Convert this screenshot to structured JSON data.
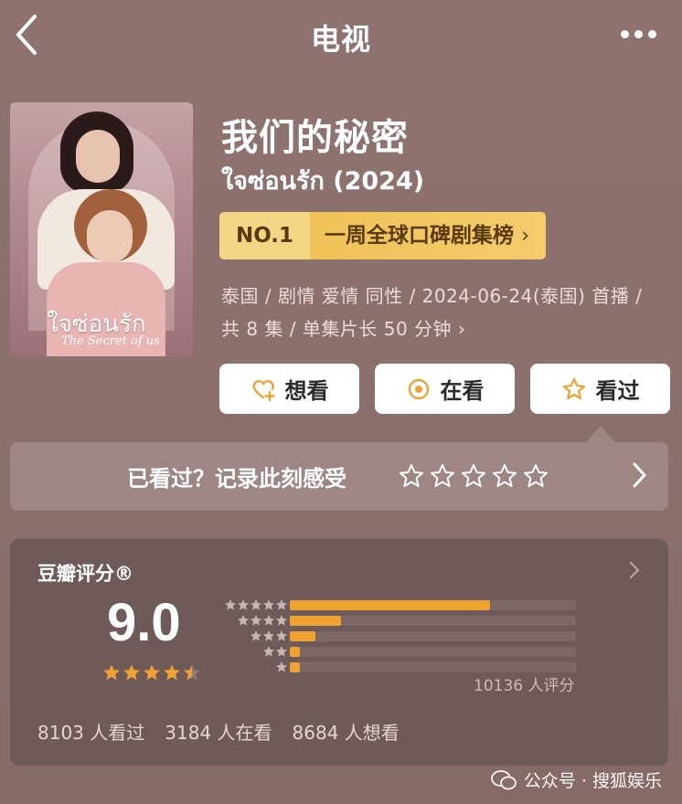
{
  "header": {
    "title": "电视"
  },
  "show": {
    "title": "我们的秘密",
    "original_title": "ใจซ่อนรัก (2024)",
    "poster_title": "ใจซ่อนรัก",
    "poster_subtitle": "The Secret of us",
    "rank": {
      "no": "NO.1",
      "name": "一周全球口碑剧集榜"
    },
    "meta": "泰国 / 剧情 爱情 同性 / 2024-06-24(泰国) 首播 / 共 8 集 / 单集片长 50 分钟"
  },
  "actions": [
    {
      "label": "想看",
      "icon": "heart-plus-icon"
    },
    {
      "label": "在看",
      "icon": "circle-dot-icon"
    },
    {
      "label": "看过",
      "icon": "star-outline-icon"
    }
  ],
  "rate_prompt": "已看过？记录此刻感受",
  "rating": {
    "label": "豆瓣评分®",
    "score": "9.0",
    "stars": 4.5,
    "distribution": [
      {
        "stars": 5,
        "pct": 0.7
      },
      {
        "stars": 4,
        "pct": 0.18
      },
      {
        "stars": 3,
        "pct": 0.09
      },
      {
        "stars": 2,
        "pct": 0.03
      },
      {
        "stars": 1,
        "pct": 0.03
      }
    ],
    "count_text": "10136 人评分",
    "stats": [
      "8103 人看过",
      "3184 人在看",
      "8684 人想看"
    ]
  },
  "colors": {
    "accent": "#f0a231",
    "badge": "#f3cc6c",
    "card": "#6e5a59"
  },
  "watermark": "公众号 · 搜狐娱乐"
}
